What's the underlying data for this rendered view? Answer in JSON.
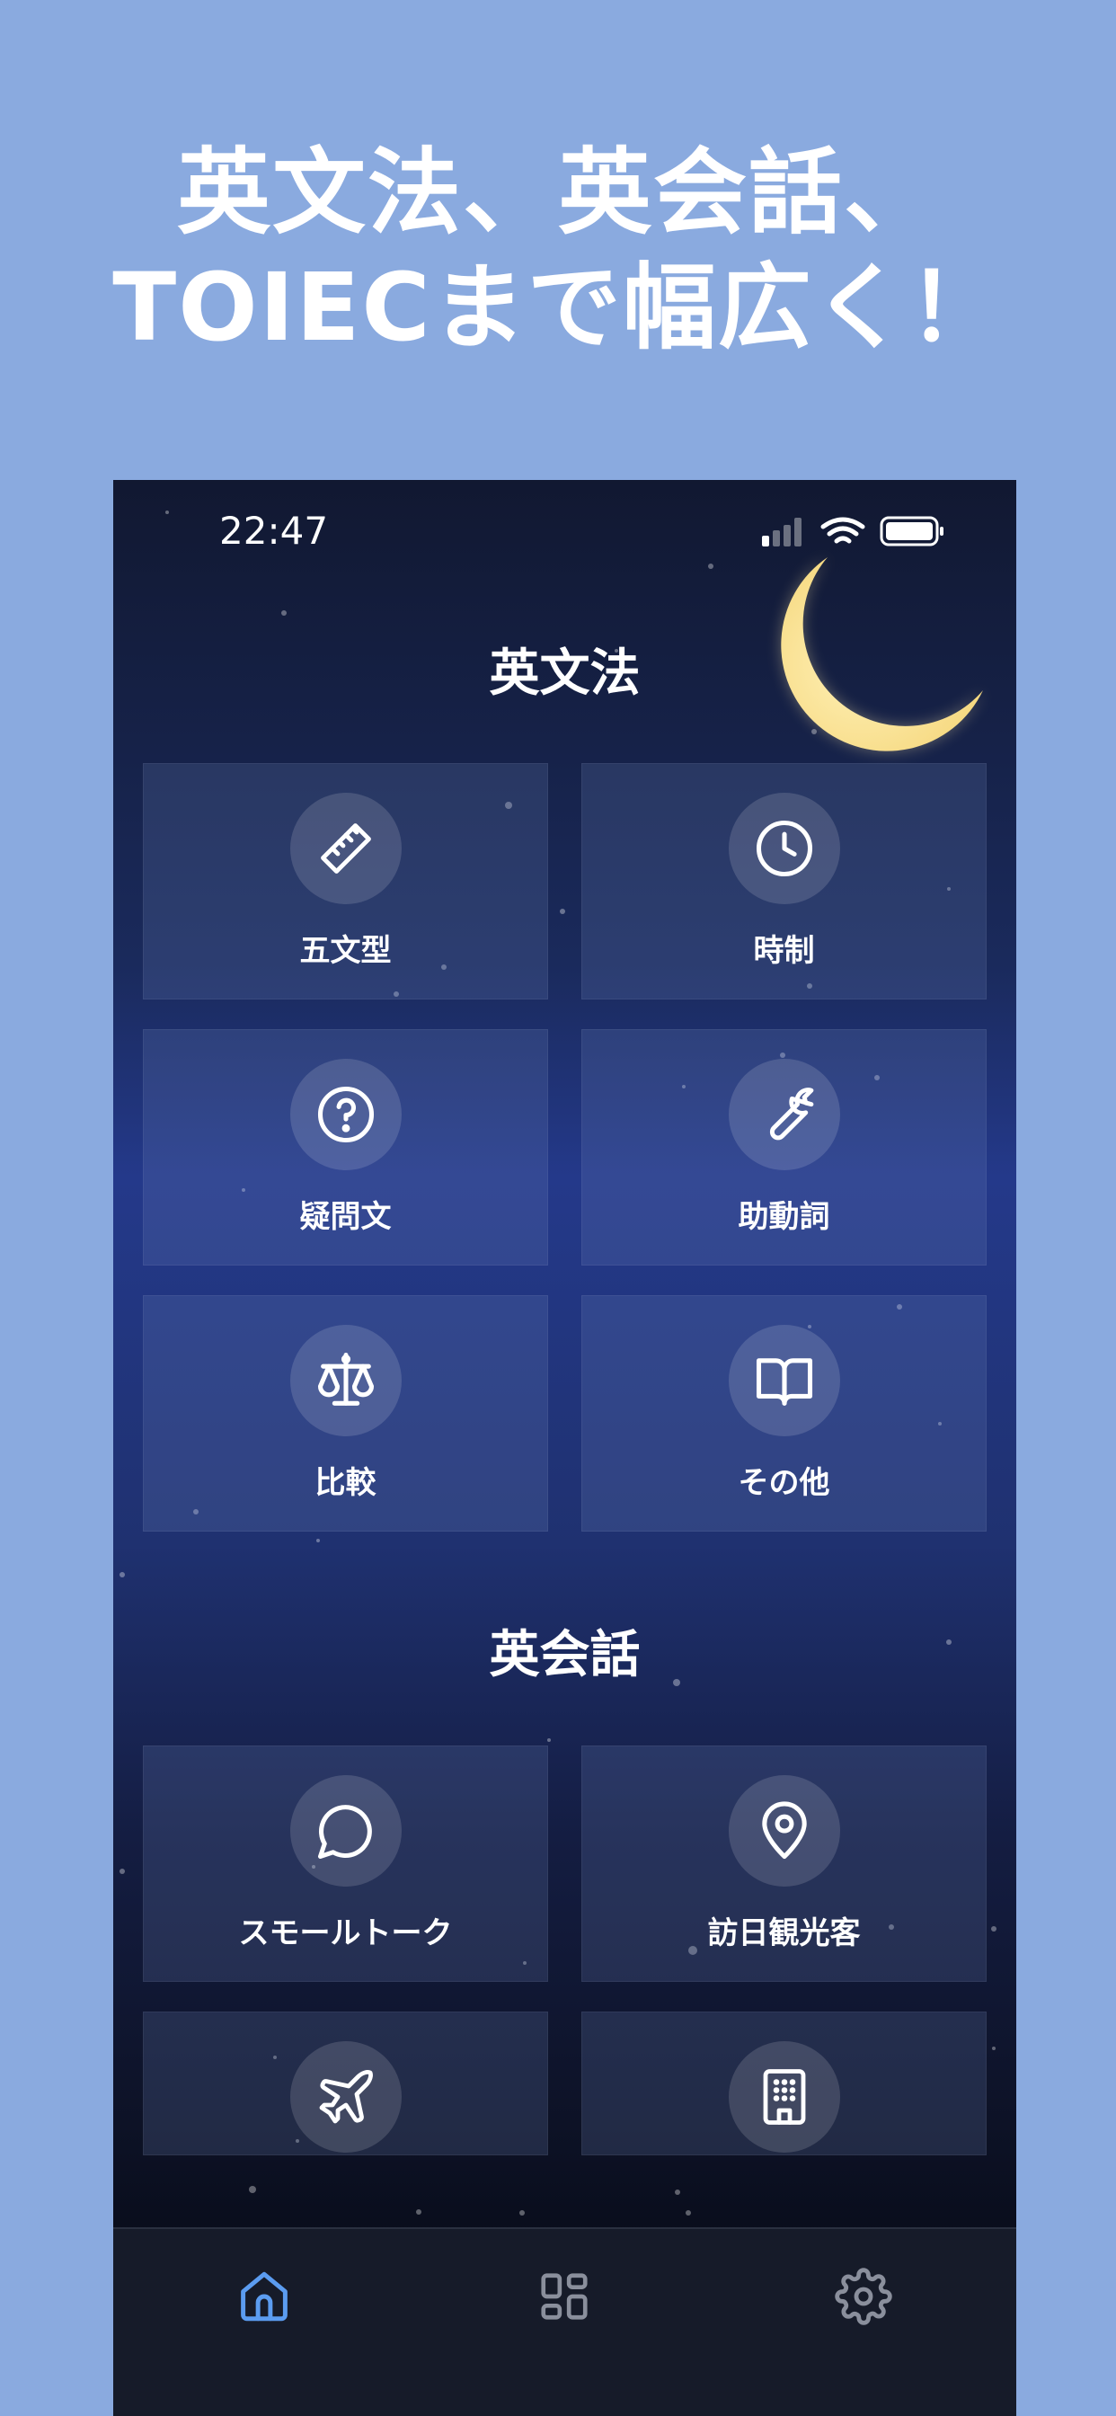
{
  "headline": {
    "line1": "英文法、英会話、",
    "line2": "TOIECまで幅広く！"
  },
  "status_bar": {
    "time": "22:47"
  },
  "sections": {
    "grammar": {
      "title": "英文法",
      "items": [
        {
          "label": "五文型",
          "icon": "ruler-icon"
        },
        {
          "label": "時制",
          "icon": "clock-icon"
        },
        {
          "label": "疑問文",
          "icon": "question-circle-icon"
        },
        {
          "label": "助動詞",
          "icon": "wrench-icon"
        },
        {
          "label": "比較",
          "icon": "scales-icon"
        },
        {
          "label": "その他",
          "icon": "book-open-icon"
        }
      ]
    },
    "conversation": {
      "title": "英会話",
      "items": [
        {
          "label": "スモールトーク",
          "icon": "chat-bubble-icon"
        },
        {
          "label": "訪日観光客",
          "icon": "map-pin-icon"
        },
        {
          "label": "",
          "icon": "airplane-icon"
        },
        {
          "label": "",
          "icon": "building-icon"
        }
      ]
    }
  },
  "tab_bar": {
    "tabs": [
      {
        "name": "home",
        "icon": "home-icon",
        "active": true
      },
      {
        "name": "categories",
        "icon": "grid-icon",
        "active": false
      },
      {
        "name": "settings",
        "icon": "gear-icon",
        "active": false
      }
    ]
  },
  "colors": {
    "background": "#8aaadf",
    "tab_active": "#5b9cf0",
    "tab_inactive": "#8a8f9c",
    "moon": "#fbe6a4"
  }
}
